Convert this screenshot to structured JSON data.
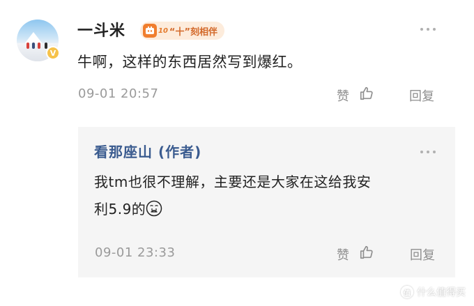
{
  "comment": {
    "username": "一斗米",
    "fan_badge": {
      "years": "10",
      "text": "“十”刻相伴",
      "icon": "fan-face-icon"
    },
    "text": "牛啊，这样的东西居然写到爆红。",
    "timestamp": "09-01 20:57",
    "like_label": "赞",
    "reply_label": "回复",
    "verify_mark": "V"
  },
  "reply": {
    "author": "看那座山 (作者)",
    "text_line1": "我tm也很不理解，主要还是大家在这给我安",
    "text_line2": "利5.9的",
    "emoji": "crying-face-emoji",
    "timestamp": "09-01 23:33",
    "like_label": "赞",
    "reply_label": "回复"
  },
  "watermark": {
    "logo_text": "值",
    "text": "什么值得买"
  },
  "colors": {
    "author_link": "#3a5b8f",
    "badge_bg": "#fdecdc",
    "badge_text": "#d3692a",
    "meta_gray": "#9a9a9a",
    "reply_bg": "#f5f5f5"
  }
}
